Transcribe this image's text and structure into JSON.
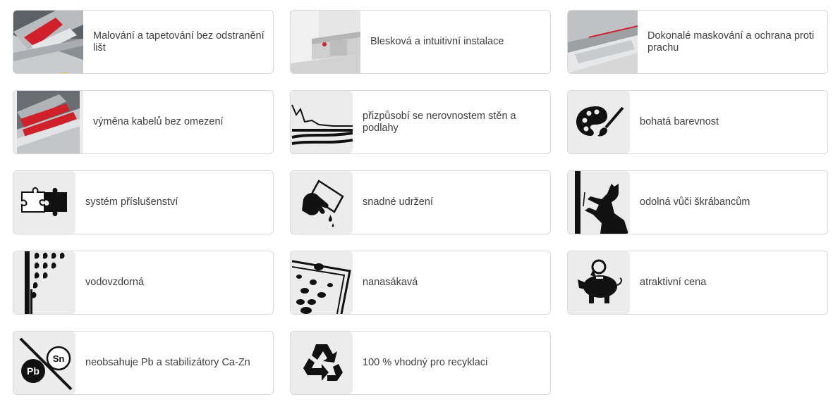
{
  "features": [
    {
      "label": "Malování a tapetování bez odstranění lišt",
      "icon": "baseboard-painting-photo"
    },
    {
      "label": "Blesková a intuitivní instalace",
      "icon": "baseboard-installation-photo"
    },
    {
      "label": "Dokonalé maskování a ochrana proti prachu",
      "icon": "baseboard-masking-photo"
    },
    {
      "label": "výměna kabelů bez omezení",
      "icon": "baseboard-cables-photo"
    },
    {
      "label": "přizpůsobí se nerovnostem stěn a podlahy",
      "icon": "uneven-wall-icon"
    },
    {
      "label": "bohatá barevnost",
      "icon": "palette-icon"
    },
    {
      "label": "systém příslušenství",
      "icon": "puzzle-icon"
    },
    {
      "label": "snadné udržení",
      "icon": "cleaning-hand-icon"
    },
    {
      "label": "odolná vůči škrábancům",
      "icon": "cat-scratch-icon"
    },
    {
      "label": "vodovzdorná",
      "icon": "water-drops-icon"
    },
    {
      "label": "nanasákavá",
      "icon": "non-absorbent-icon"
    },
    {
      "label": "atraktivní cena",
      "icon": "piggy-bank-icon"
    },
    {
      "label": "neobsahuje Pb a stabilizátory Ca-Zn",
      "icon": "no-lead-icon",
      "glyphs": [
        "Pb",
        "Sn"
      ]
    },
    {
      "label": "100 % vhodný pro recyklaci",
      "icon": "recycle-icon"
    }
  ],
  "colors": {
    "accent_red": "#d0202a",
    "icon_black": "#111111",
    "thumb_bg": "#ececec",
    "border": "#d9d9d9",
    "text": "#3f3f3f"
  }
}
